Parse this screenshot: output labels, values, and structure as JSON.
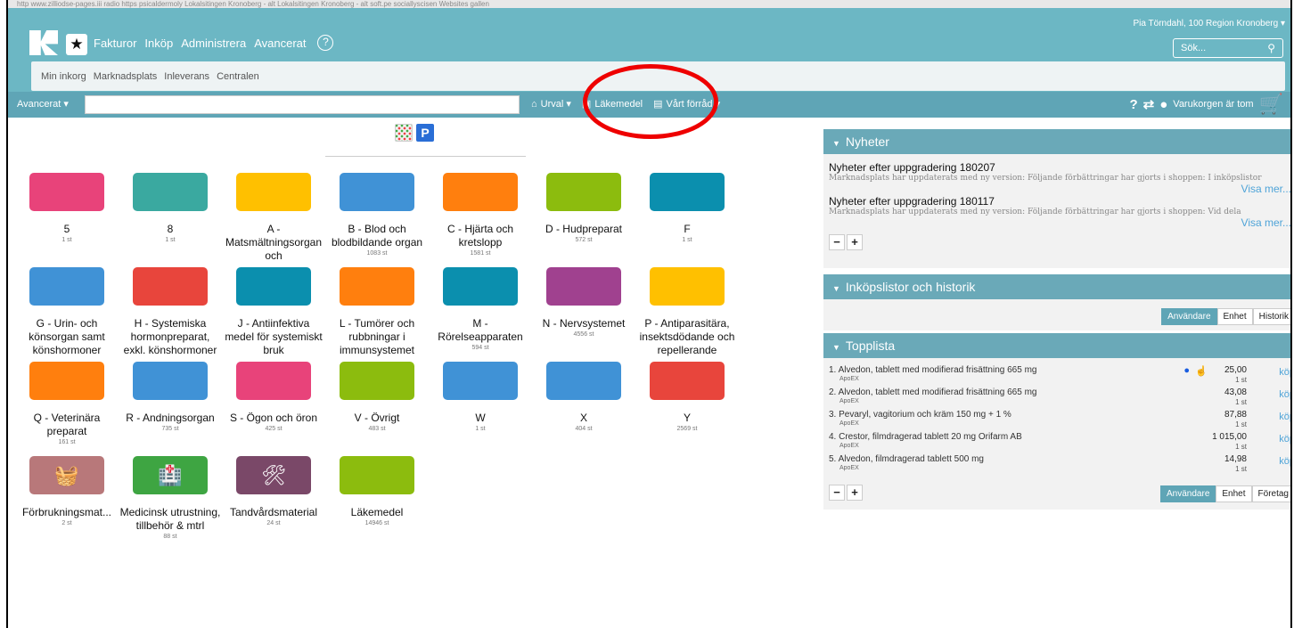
{
  "browser": {
    "bookmarks": "http  www.zilliodse-pages.iii   radio   https  psicaldermoly   Lokalsitingen Kronoberg - alt   Lokalsitingen Kronoberg - alt   soft.pe sociallyscisen   Websites gallen"
  },
  "header": {
    "nav": [
      "Fakturor",
      "Inköp",
      "Administrera",
      "Avancerat"
    ],
    "help": "?",
    "user": "Pia Törndahl, 100 Region Kronoberg ▾",
    "search_placeholder": "Sök...",
    "subnav": [
      "Min inkorg",
      "Marknadsplats",
      "Inleverans",
      "Centralen"
    ]
  },
  "toolbar": {
    "advanced": "Avancerat ▾",
    "quick": [
      {
        "icon": "home-icon",
        "label": "Urval ▾"
      },
      {
        "icon": "medkit-icon",
        "label": "Läkemedel"
      },
      {
        "icon": "warehouse-icon",
        "label": "Vårt förråd ▾"
      }
    ],
    "help": "?",
    "cart": "Varukorgen är tom"
  },
  "view": {
    "p_label": "P"
  },
  "categories": [
    {
      "name": "5",
      "count": "1 st",
      "color": "#e8437a",
      "col": 0,
      "row": 0
    },
    {
      "name": "8",
      "count": "1 st",
      "color": "#3aa9a0",
      "col": 1,
      "row": 0
    },
    {
      "name": "A - Matsmältningsorgan och",
      "count": "",
      "color": "#ffc000",
      "col": 2,
      "row": 0
    },
    {
      "name": "B - Blod och blodbildande organ",
      "count": "1083 st",
      "color": "#4092d6",
      "col": 3,
      "row": 0
    },
    {
      "name": "C - Hjärta och kretslopp",
      "count": "1581 st",
      "color": "#ff7f0e",
      "col": 4,
      "row": 0
    },
    {
      "name": "D - Hudpreparat",
      "count": "572 st",
      "color": "#8cbc0e",
      "col": 5,
      "row": 0
    },
    {
      "name": "F",
      "count": "1 st",
      "color": "#0b8fae",
      "col": 6,
      "row": 0
    },
    {
      "name": "G - Urin- och könsorgan samt könshormoner",
      "count": "",
      "color": "#4092d6",
      "col": 0,
      "row": 1
    },
    {
      "name": "H - Systemiska hormonpreparat, exkl. könshormoner",
      "count": "",
      "color": "#e8453c",
      "col": 1,
      "row": 1
    },
    {
      "name": "J - Antiinfektiva medel för systemiskt bruk",
      "count": "",
      "color": "#0b8fae",
      "col": 2,
      "row": 1
    },
    {
      "name": "L - Tumörer och rubbningar i immunsystemet",
      "count": "",
      "color": "#ff7f0e",
      "col": 3,
      "row": 1
    },
    {
      "name": "M - Rörelseapparaten",
      "count": "594 st",
      "color": "#0b8fae",
      "col": 4,
      "row": 1
    },
    {
      "name": "N - Nervsystemet",
      "count": "4556 st",
      "color": "#a0418f",
      "col": 5,
      "row": 1
    },
    {
      "name": "P - Antiparasitära, insektsdödande och repellerande",
      "count": "",
      "color": "#ffc000",
      "col": 6,
      "row": 1
    },
    {
      "name": "Q - Veterinära preparat",
      "count": "161 st",
      "color": "#ff7f0e",
      "col": 0,
      "row": 2
    },
    {
      "name": "R - Andningsorgan",
      "count": "735 st",
      "color": "#4092d6",
      "col": 1,
      "row": 2
    },
    {
      "name": "S - Ögon och öron",
      "count": "425 st",
      "color": "#e8437a",
      "col": 2,
      "row": 2
    },
    {
      "name": "V - Övrigt",
      "count": "483 st",
      "color": "#8cbc0e",
      "col": 3,
      "row": 2
    },
    {
      "name": "W",
      "count": "1 st",
      "color": "#4092d6",
      "col": 4,
      "row": 2
    },
    {
      "name": "X",
      "count": "404 st",
      "color": "#4092d6",
      "col": 5,
      "row": 2
    },
    {
      "name": "Y",
      "count": "2569 st",
      "color": "#e8453c",
      "col": 6,
      "row": 2
    },
    {
      "name": "Förbrukningsmat...",
      "count": "2 st",
      "color": "#b8787a",
      "col": 0,
      "row": 3,
      "icon": "basket-icon"
    },
    {
      "name": "Medicinsk utrustning, tillbehör & mtrl",
      "count": "88 st",
      "color": "#3ea542",
      "col": 1,
      "row": 3,
      "icon": "hospital-icon"
    },
    {
      "name": "Tandvårdsmaterial",
      "count": "24 st",
      "color": "#7a4868",
      "col": 2,
      "row": 3,
      "icon": "dental-tools-icon"
    },
    {
      "name": "Läkemedel",
      "count": "14946 st",
      "color": "#8cbc0e",
      "col": 3,
      "row": 3
    }
  ],
  "news": {
    "title": "Nyheter",
    "items": [
      {
        "title": "Nyheter efter uppgradering 180207",
        "desc": "Marknadsplats har uppdaterats med ny version: Följande förbättringar har gjorts i shoppen: I inköpslistor",
        "more": "Visa mer..."
      },
      {
        "title": "Nyheter efter uppgradering 180117",
        "desc": "Marknadsplats har uppdaterats med ny version: Följande förbättringar har gjorts i shoppen: Vid dela",
        "more": "Visa mer..."
      }
    ]
  },
  "history": {
    "title": "Inköpslistor och historik",
    "buttons": [
      "Användare",
      "Enhet",
      "Historik"
    ]
  },
  "toplist": {
    "title": "Topplista",
    "items": [
      {
        "name": "1. Alvedon, tablett med modifierad frisättning 665 mg",
        "supplier": "ApoEX",
        "price": "25,00",
        "unit": "1 st",
        "buy": "köp",
        "marked": true
      },
      {
        "name": "2. Alvedon, tablett med modifierad frisättning 665 mg",
        "supplier": "ApoEX",
        "price": "43,08",
        "unit": "1 st",
        "buy": "köp"
      },
      {
        "name": "3. Pevaryl, vagitorium och kräm 150 mg + 1 %",
        "supplier": "ApoEX",
        "price": "87,88",
        "unit": "1 st",
        "buy": "köp"
      },
      {
        "name": "4. Crestor, filmdragerad tablett 20 mg Orifarm AB",
        "supplier": "ApoEX",
        "price": "1 015,00",
        "unit": "1 st",
        "buy": "köp"
      },
      {
        "name": "5. Alvedon, filmdragerad tablett 500 mg",
        "supplier": "ApoEX",
        "price": "14,98",
        "unit": "1 st",
        "buy": "köp"
      }
    ],
    "buttons": [
      "Användare",
      "Enhet",
      "Företag"
    ]
  },
  "colors": {
    "header": "#6cb7c4",
    "toolbar": "#5fa5b6",
    "link": "#4fa4d8",
    "annotation": "#ee0000"
  }
}
